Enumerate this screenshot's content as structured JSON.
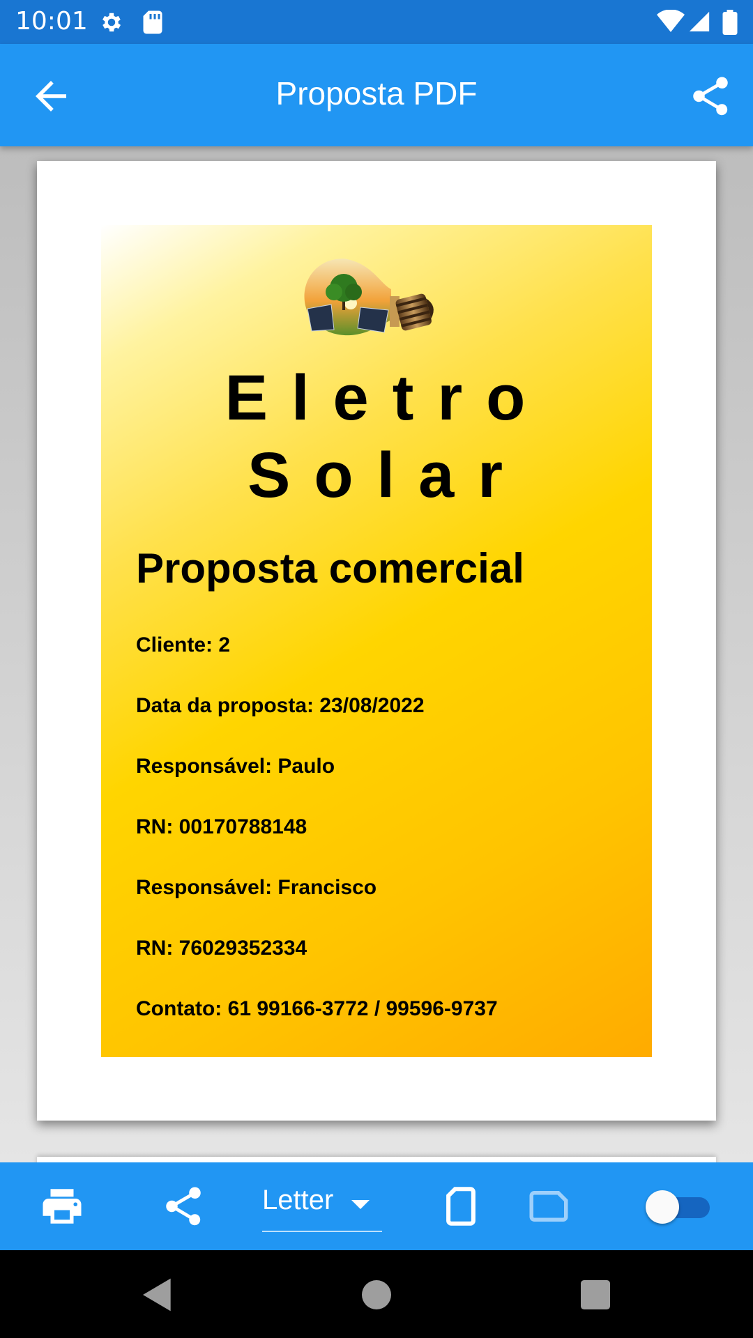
{
  "status_bar": {
    "time": "10:01"
  },
  "app_bar": {
    "title": "Proposta PDF"
  },
  "document": {
    "brand_line1": "Eletro",
    "brand_line2": "Solar",
    "title": "Proposta comercial",
    "lines": [
      "Cliente: 2",
      "Data da proposta: 23/08/2022",
      "Responsável: Paulo",
      "RN: 00170788148",
      "Responsável: Francisco",
      "RN: 76029352334",
      "Contato: 61 99166-3772 / 99596-9737"
    ]
  },
  "toolbar": {
    "page_format": "Letter",
    "icons": [
      "print-icon",
      "share-icon",
      "portrait-icon",
      "landscape-icon",
      "toggle-switch"
    ]
  },
  "colors": {
    "primary": "#2196F3",
    "status_bar": "#1976D2",
    "cover_top": "#fff3a0",
    "cover_bottom": "#ffab00"
  }
}
